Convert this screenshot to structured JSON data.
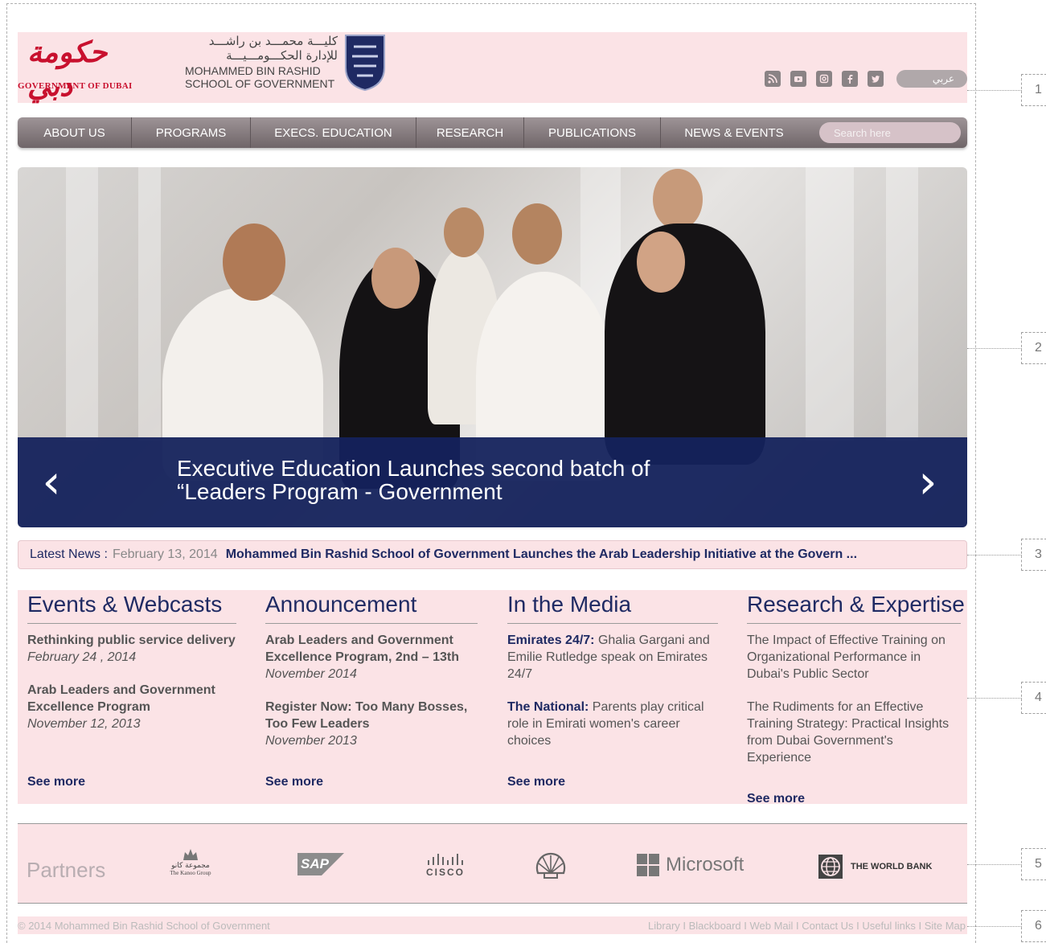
{
  "header": {
    "dubai_logo_arabic": "حكومة دبي",
    "dubai_logo_text": "GOVERNMENT OF DUBAI",
    "school_arabic_line1": "كليـــة محمـــد بن راشـــد",
    "school_arabic_line2": "للإدارة الحكـــومـــيـــة",
    "school_en_line1": "MOHAMMED BIN RASHID",
    "school_en_line2": "SCHOOL OF GOVERNMENT",
    "social_icons": [
      "rss-icon",
      "youtube-icon",
      "instagram-icon",
      "facebook-icon",
      "twitter-icon"
    ],
    "language_button": "عربي"
  },
  "nav": {
    "items": [
      "ABOUT US",
      "PROGRAMS",
      "EXECS. EDUCATION",
      "RESEARCH",
      "PUBLICATIONS",
      "NEWS & EVENTS"
    ],
    "search_placeholder": "Search here"
  },
  "hero": {
    "caption": "Executive Education Launches second batch of “Leaders Program - Government",
    "prev_arrow": "‹",
    "next_arrow": "›"
  },
  "latest_news": {
    "label": "Latest News :",
    "date": "February  13, 2014",
    "headline": "Mohammed Bin Rashid School of Government Launches the Arab Leadership Initiative at the Govern ..."
  },
  "columns": {
    "events": {
      "title": "Events & Webcasts",
      "items": [
        {
          "title": "Rethinking public service delivery",
          "date": "February 24 , 2014"
        },
        {
          "title": "Arab Leaders and Government Excellence Program",
          "date": "November  12, 2013"
        }
      ],
      "see_more": "See more"
    },
    "announcement": {
      "title": "Announcement",
      "items": [
        {
          "title": "Arab Leaders and Government Excellence Program, 2nd – 13th",
          "date": "November 2014"
        },
        {
          "title": "Register Now: Too Many Bosses, Too Few Leaders",
          "date": "November 2013"
        }
      ],
      "see_more": "See more"
    },
    "media": {
      "title": "In the Media",
      "items": [
        {
          "source": "Emirates 24/7:",
          "text": " Ghalia Gargani and Emilie Rutledge speak on Emirates 24/7"
        },
        {
          "source": "The National:",
          "text": " Parents play critical role in Emirati women's career choices"
        }
      ],
      "see_more": "See more"
    },
    "research": {
      "title": "Research & Expertise",
      "items": [
        {
          "text": "The Impact of Effective Training on Organizational Performance in Dubai's Public Sector"
        },
        {
          "text": "The Rudiments for an Effective Training Strategy: Practical Insights from Dubai Government's Experience"
        }
      ],
      "see_more": "See more"
    }
  },
  "partners": {
    "label": "Partners",
    "logos": {
      "kanoo_arabic": "مجموعة كانو",
      "kanoo": "The Kanoo Group",
      "sap": "SAP",
      "cisco": "CISCO",
      "microsoft": "Microsoft",
      "worldbank": "THE WORLD BANK"
    }
  },
  "footer": {
    "copyright": "© 2014 Mohammed Bin Rashid School of Government",
    "links": "Library I Blackboard I Web Mail I Contact Us I Useful links I Site Map"
  },
  "annotations": [
    "1",
    "2",
    "3",
    "4",
    "5",
    "6"
  ],
  "colors": {
    "pink_bg": "#fbe3e6",
    "navy": "#1f2a63",
    "brand_red": "#c8102e",
    "nav_grey": "#7f7477"
  }
}
